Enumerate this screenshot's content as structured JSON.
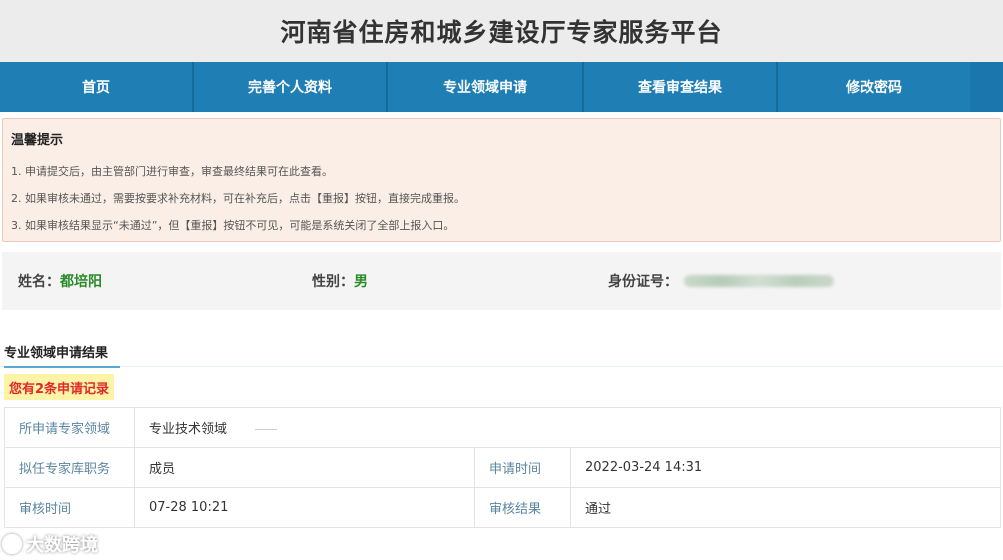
{
  "header": {
    "title": "河南省住房和城乡建设厅专家服务平台"
  },
  "nav": {
    "items": [
      {
        "label": "首页"
      },
      {
        "label": "完善个人资料"
      },
      {
        "label": "专业领域申请"
      },
      {
        "label": "查看审查结果"
      },
      {
        "label": "修改密码"
      }
    ],
    "color": "#1f7fb5"
  },
  "tips": {
    "title": "温馨提示",
    "lines": [
      "1. 申请提交后，由主管部门进行审查，审查最终结果可在此查看。",
      "2. 如果审核未通过，需要按要求补充材料，可在补充后，点击【重报】按钮，直接完成重报。",
      "3. 如果审核结果显示“未通过”，但【重报】按钮不可见，可能是系统关闭了全部上报入口。"
    ]
  },
  "person": {
    "name_label": "姓名：",
    "name": "都培阳",
    "gender_label": "性别：",
    "gender": "男",
    "id_label": "身份证号："
  },
  "result": {
    "section_title": "专业领域申请结果",
    "record_count_text": "您有2条申请记录",
    "rows": {
      "field_label": "所申请专家领域",
      "field_value": "专业技术领域",
      "position_label": "拟任专家库职务",
      "position_value": "成员",
      "apply_time_label": "申请时间",
      "apply_time_value": "2022-03-24 14:31",
      "review_time_label": "审核时间",
      "review_time_value": "07-28 10:21",
      "review_result_label": "审核结果",
      "review_result_value": "通过"
    }
  },
  "watermark": {
    "text": "大数跨境"
  },
  "colors": {
    "pass": "#2a8a2a",
    "highlight_red": "#e02a2a",
    "tips_bg": "#fbeee7"
  }
}
